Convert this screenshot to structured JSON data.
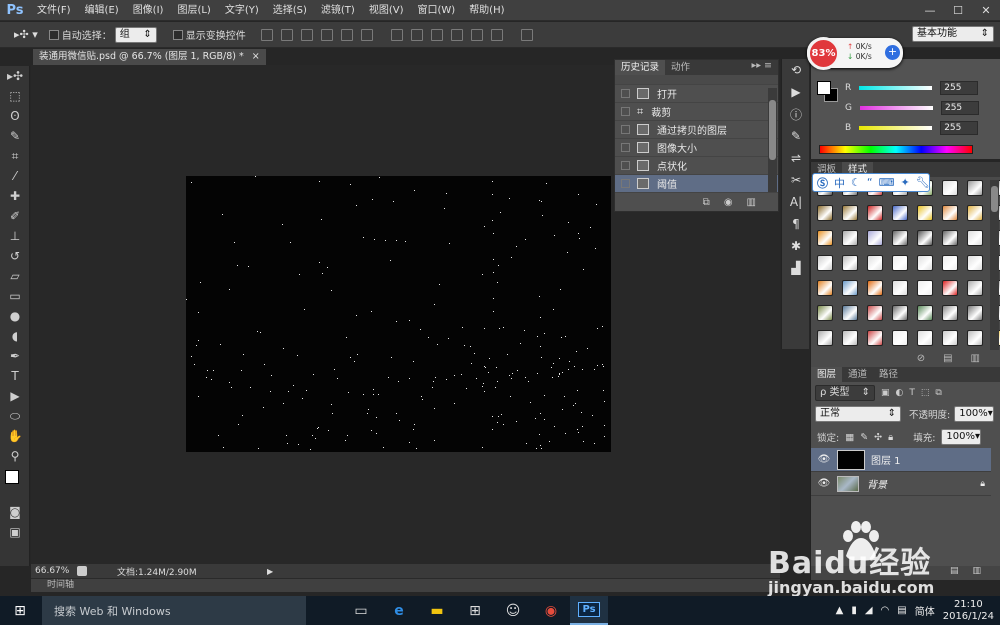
{
  "app": {
    "logo": "Ps",
    "accent": "#8fc3ff"
  },
  "menu": [
    "文件(F)",
    "编辑(E)",
    "图像(I)",
    "图层(L)",
    "文字(Y)",
    "选择(S)",
    "滤镜(T)",
    "视图(V)",
    "窗口(W)",
    "帮助(H)"
  ],
  "window_controls": {
    "minimize": "—",
    "maximize": "☐",
    "close": "✕"
  },
  "options": {
    "auto_select_label": "自动选择：",
    "auto_select_value": "组",
    "show_transform_label": "显示变换控件",
    "workspace": "基本功能"
  },
  "document": {
    "tab_title": "装通用微信贴.psd @ 66.7% (图层 1, RGB/8) *",
    "tab_close": "×",
    "zoom": "66.67%",
    "doc_info": "文档:1.24M/2.90M"
  },
  "timeline_label": "时间轴",
  "history": {
    "tabs": [
      "历史记录",
      "动作"
    ],
    "items": [
      "打开",
      "裁剪",
      "通过拷贝的图层",
      "图像大小",
      "点状化",
      "阈值"
    ],
    "selected": "阈值"
  },
  "speed_widget": {
    "percent": "83%",
    "up": "0K/s",
    "down": "0K/s"
  },
  "color_panel": {
    "channels": [
      {
        "label": "R",
        "value": "255",
        "color": "#20e0e0"
      },
      {
        "label": "G",
        "value": "255",
        "color": "#e040e0"
      },
      {
        "label": "B",
        "value": "255",
        "color": "#e0e020"
      }
    ]
  },
  "styles_panel": {
    "tabs": [
      "调板",
      "样式"
    ],
    "ime_text": "中"
  },
  "layers_panel": {
    "tabs": [
      "图层",
      "通道",
      "路径"
    ],
    "filter_label": "ρ 类型",
    "blend_mode": "正常",
    "opacity_label": "不透明度:",
    "opacity_value": "100%",
    "lock_label": "锁定:",
    "fill_label": "填充:",
    "fill_value": "100%",
    "layers": [
      {
        "name": "图层 1",
        "selected": true
      },
      {
        "name": "背景",
        "selected": false
      }
    ]
  },
  "taskbar": {
    "search_placeholder": "搜索 Web 和 Windows",
    "ime": "简体",
    "time": "21:10",
    "date": "2016/1/24"
  },
  "watermark": {
    "text": "Baidu经验",
    "url": "jingyan.baidu.com"
  }
}
